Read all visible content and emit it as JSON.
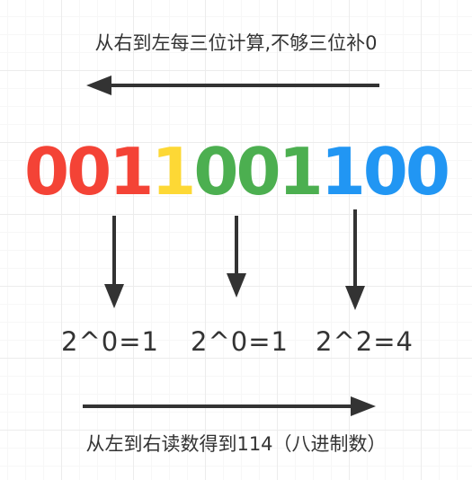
{
  "diagram": {
    "top_caption": "从右到左每三位计算,不够三位补0",
    "bottom_caption": "从左到右读数得到114（八进制数）",
    "digits": [
      {
        "text": "001",
        "color": "#f44336"
      },
      {
        "text": "1",
        "color": "#fdd835"
      },
      {
        "text": "001",
        "color": "#4caf50"
      },
      {
        "text": "100",
        "color": "#2196f3"
      }
    ],
    "results": [
      "2^0=1",
      "2^0=1",
      "2^2=4"
    ],
    "arrow_color": "#333333"
  }
}
